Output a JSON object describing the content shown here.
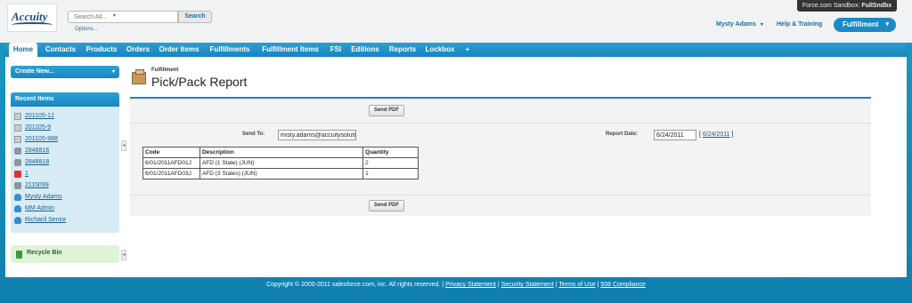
{
  "header": {
    "logo_text": "Accuity",
    "search_placeholder": "Search All...",
    "search_scope_chevron": "▾",
    "search_button": "Search",
    "options_link": "Options...",
    "sandbox_prefix": "Force.com Sandbox: ",
    "sandbox_name": "FullSndbx",
    "user_name": "Mysty Adams",
    "user_chevron": "▾",
    "help_link": "Help & Training",
    "app_menu": "Fulfillment",
    "app_chevron": "▾"
  },
  "tabs": [
    {
      "label": "Home",
      "active": true
    },
    {
      "label": "Contacts"
    },
    {
      "label": "Products"
    },
    {
      "label": "Orders"
    },
    {
      "label": "Order Items"
    },
    {
      "label": "Fulfillments"
    },
    {
      "label": "Fulfillment Items"
    },
    {
      "label": "FSI"
    },
    {
      "label": "Editions"
    },
    {
      "label": "Reports"
    },
    {
      "label": "Lockbox"
    },
    {
      "label": "+"
    }
  ],
  "sidebar": {
    "create_new": "Create New...",
    "create_chevron": "▾",
    "recent_title": "Recent Items",
    "recent_items": [
      {
        "label": "201105-12",
        "icon": "document-icon"
      },
      {
        "label": "201105-9",
        "icon": "document-icon"
      },
      {
        "label": "201105-988",
        "icon": "document-icon"
      },
      {
        "label": "2848816",
        "icon": "package-icon"
      },
      {
        "label": "2848818",
        "icon": "package-icon"
      },
      {
        "label": "1",
        "icon": "order-icon"
      },
      {
        "label": "2115099",
        "icon": "package-icon"
      },
      {
        "label": "Mysty Adams",
        "icon": "user-icon"
      },
      {
        "label": "MM Admin",
        "icon": "user-icon"
      },
      {
        "label": "Richard Senior",
        "icon": "user-icon"
      }
    ],
    "recycle_bin": "Recycle Bin",
    "collapse_glyph": "◂"
  },
  "main": {
    "kicker": "Fulfillment",
    "title": "Pick/Pack Report",
    "send_pdf": "Send PDF",
    "send_to_label": "Send To:",
    "send_to_value": "misty.adams@accuitysolutions.com",
    "report_date_label": "Report Date:",
    "report_date_value": "6/24/2011",
    "report_date_bracket_open": "[",
    "report_date_link": "6/24/2011",
    "report_date_bracket_close": "]",
    "table": {
      "headers": [
        "Code",
        "Description",
        "Quantity"
      ],
      "rows": [
        [
          "6/01/2011AFD01J",
          "AFD (1 State) (JUN)",
          "2"
        ],
        [
          "6/01/2011AFD03J",
          "AFD (3 States) (JUN)",
          "1"
        ]
      ]
    }
  },
  "footer": {
    "copyright": "Copyright © 2000-2011 salesforce.com, inc. All rights reserved. |",
    "links": [
      "Privacy Statement",
      "Security Statement",
      "Terms of Use",
      "508 Compliance"
    ],
    "separator": "|"
  }
}
